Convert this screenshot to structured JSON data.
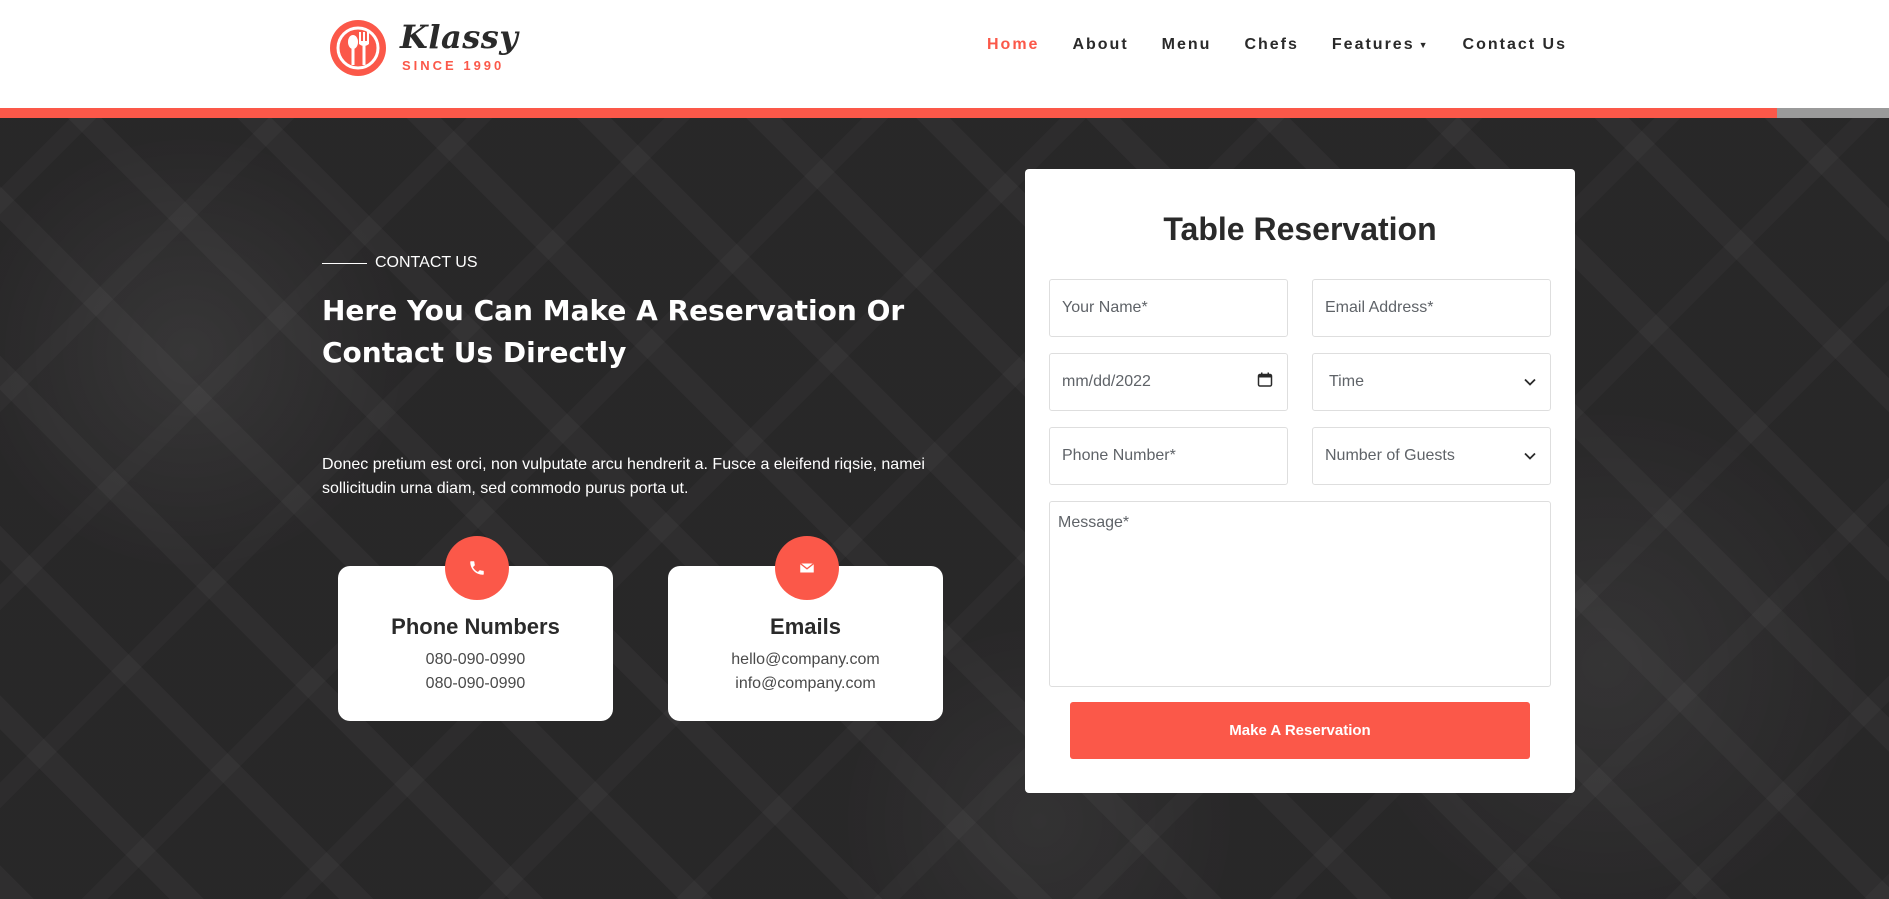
{
  "brand": {
    "name": "Klassy",
    "since": "SINCE 1990",
    "accent_color": "#fb5849"
  },
  "nav": {
    "items": [
      {
        "label": "Home",
        "active": true
      },
      {
        "label": "About"
      },
      {
        "label": "Menu"
      },
      {
        "label": "Chefs"
      },
      {
        "label": "Features",
        "has_dropdown": true
      },
      {
        "label": "Contact Us"
      }
    ]
  },
  "contact": {
    "eyebrow": "CONTACT US",
    "heading": "Here You Can Make A Reservation Or Contact Us Directly",
    "intro": "Donec pretium est orci, non vulputate arcu hendrerit a. Fusce a eleifend riqsie, namei sollicitudin urna diam, sed commodo purus porta ut.",
    "cards": [
      {
        "icon": "phone-icon",
        "title": "Phone Numbers",
        "lines": [
          "080-090-0990",
          "080-090-0990"
        ]
      },
      {
        "icon": "envelope-icon",
        "title": "Emails",
        "lines": [
          "hello@company.com",
          "info@company.com"
        ]
      }
    ]
  },
  "reservation": {
    "title": "Table Reservation",
    "name_placeholder": "Your Name*",
    "email_placeholder": "Email Address*",
    "date_placeholder": "mm/dd/2022",
    "time_label": "Time",
    "phone_placeholder": "Phone Number*",
    "guests_label": "Number of Guests",
    "message_placeholder": "Message*",
    "submit_label": "Make A Reservation"
  }
}
